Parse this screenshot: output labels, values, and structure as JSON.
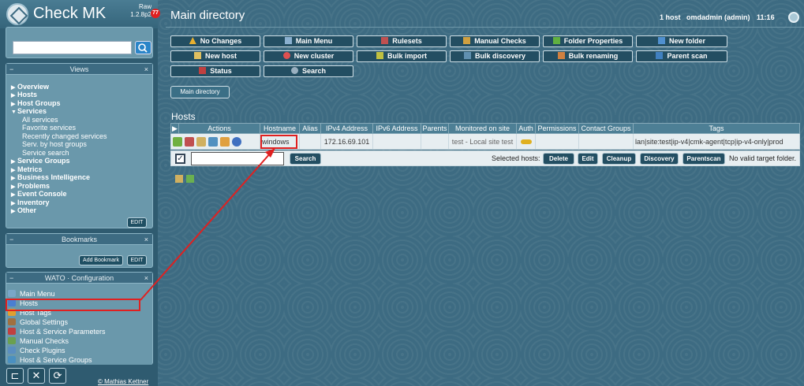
{
  "app": {
    "brand": "Check MK",
    "edition_line1": "Raw",
    "edition_line2": "1.2.8p2",
    "badge_count": "77"
  },
  "header": {
    "title": "Main directory",
    "host_count": "1 host",
    "user": "omdadmin (admin)",
    "time": "11:16"
  },
  "sidebar": {
    "views": {
      "title": "Views",
      "items": [
        {
          "label": "Overview"
        },
        {
          "label": "Hosts"
        },
        {
          "label": "Host Groups"
        },
        {
          "label": "Services"
        },
        {
          "label": "All services"
        },
        {
          "label": "Favorite services"
        },
        {
          "label": "Recently changed services"
        },
        {
          "label": "Serv. by host groups"
        },
        {
          "label": "Service search"
        },
        {
          "label": "Service Groups"
        },
        {
          "label": "Metrics"
        },
        {
          "label": "Business Intelligence"
        },
        {
          "label": "Problems"
        },
        {
          "label": "Event Console"
        },
        {
          "label": "Inventory"
        },
        {
          "label": "Other"
        }
      ],
      "edit_label": "EDIT"
    },
    "bookmarks": {
      "title": "Bookmarks",
      "add_label": "Add Bookmark",
      "edit_label": "EDIT"
    },
    "wato": {
      "title": "WATO · Configuration",
      "items": [
        {
          "label": "Main Menu",
          "color": "#7aa6c8"
        },
        {
          "label": "Hosts",
          "color": "#4a7fd1"
        },
        {
          "label": "Host Tags",
          "color": "#e0a030"
        },
        {
          "label": "Global Settings",
          "color": "#a07040"
        },
        {
          "label": "Host & Service Parameters",
          "color": "#c04040"
        },
        {
          "label": "Manual Checks",
          "color": "#6aa050"
        },
        {
          "label": "Check Plugins",
          "color": "#5a8ec0"
        },
        {
          "label": "Host & Service Groups",
          "color": "#4a90c0"
        }
      ]
    },
    "footer_copy": "© Mathias Kettner"
  },
  "toolbar": {
    "buttons": [
      {
        "label": "No Changes",
        "icon": "warning-icon",
        "color": "#e8b030"
      },
      {
        "label": "Main Menu",
        "icon": "home-icon",
        "color": "#8ab0d0"
      },
      {
        "label": "Rulesets",
        "icon": "rulesets-icon",
        "color": "#c05050"
      },
      {
        "label": "Manual Checks",
        "icon": "pen-icon",
        "color": "#d0a040"
      },
      {
        "label": "Folder Properties",
        "icon": "pencil-icon",
        "color": "#60b040"
      },
      {
        "label": "New folder",
        "icon": "folder-icon",
        "color": "#5090d0"
      },
      {
        "label": "New host",
        "icon": "new-host-icon",
        "color": "#e0c060"
      },
      {
        "label": "New cluster",
        "icon": "cluster-icon",
        "color": "#e05050"
      },
      {
        "label": "Bulk import",
        "icon": "import-icon",
        "color": "#c0c040"
      },
      {
        "label": "Bulk discovery",
        "icon": "discovery-icon",
        "color": "#6090b0"
      },
      {
        "label": "Bulk renaming",
        "icon": "rename-icon",
        "color": "#d08040"
      },
      {
        "label": "Parent scan",
        "icon": "parent-scan-icon",
        "color": "#4080c0"
      },
      {
        "label": "Status",
        "icon": "status-icon",
        "color": "#c04040"
      },
      {
        "label": "Search",
        "icon": "search-icon",
        "color": "#9ab0c0"
      }
    ]
  },
  "breadcrumb": "Main directory",
  "hosts_section": {
    "title": "Hosts",
    "columns": [
      "Actions",
      "Hostname",
      "Alias",
      "IPv4 Address",
      "IPv6 Address",
      "Parents",
      "Monitored on site",
      "Auth",
      "Permissions",
      "Contact Groups",
      "Tags"
    ],
    "rows": [
      {
        "hostname": "windows",
        "alias": "",
        "ipv4": "172.16.69.101",
        "ipv6": "",
        "parents": "",
        "site": "test - Local site test",
        "permissions": "",
        "contact_groups": "",
        "tags": "lan|site:test|ip-v4|cmk-agent|tcp|ip-v4-only|prod"
      }
    ],
    "search_button": "Search",
    "selected_label": "Selected hosts:",
    "bulk_buttons": [
      "Delete",
      "Edit",
      "Cleanup",
      "Discovery",
      "Parentscan"
    ],
    "no_target": "No valid target folder."
  }
}
